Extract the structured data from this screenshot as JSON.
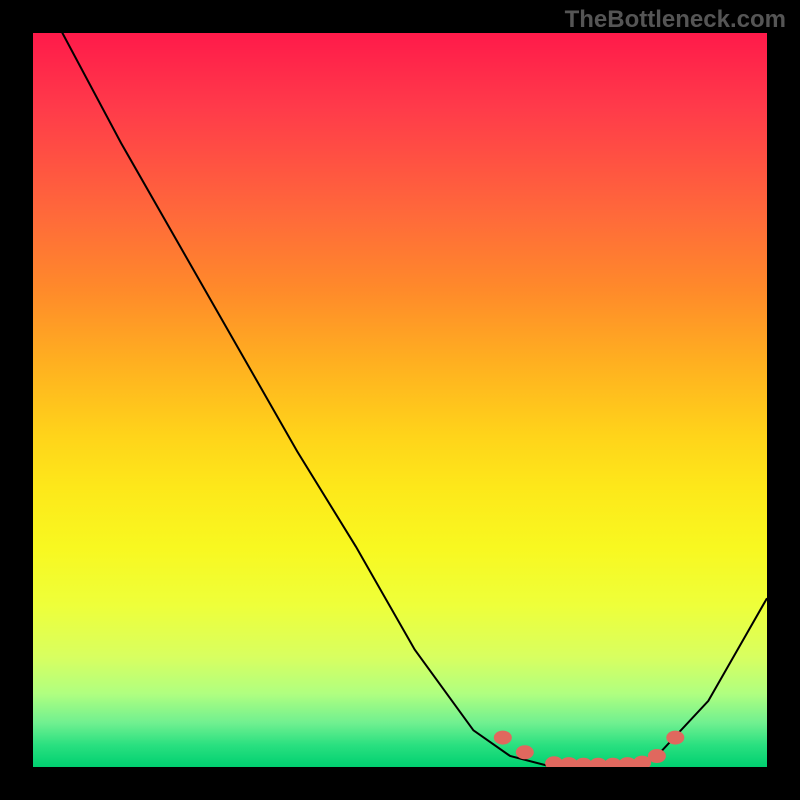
{
  "watermark": "TheBottleneck.com",
  "chart_data": {
    "type": "line",
    "title": "",
    "xlabel": "",
    "ylabel": "",
    "xlim": [
      0,
      100
    ],
    "ylim": [
      0,
      100
    ],
    "grid": false,
    "legend": false,
    "series": [
      {
        "name": "curve",
        "x": [
          0,
          4,
          12,
          20,
          28,
          36,
          44,
          52,
          60,
          65,
          70,
          75,
          80,
          85,
          92,
          100
        ],
        "y": [
          116,
          100,
          85,
          71,
          57,
          43,
          30,
          16,
          5,
          1.5,
          0.2,
          0,
          0,
          1.5,
          9,
          23
        ]
      }
    ],
    "markers": [
      {
        "x": 64,
        "y": 4
      },
      {
        "x": 67,
        "y": 2
      },
      {
        "x": 71,
        "y": 0.5
      },
      {
        "x": 73,
        "y": 0.4
      },
      {
        "x": 75,
        "y": 0.3
      },
      {
        "x": 77,
        "y": 0.3
      },
      {
        "x": 79,
        "y": 0.3
      },
      {
        "x": 81,
        "y": 0.4
      },
      {
        "x": 83,
        "y": 0.6
      },
      {
        "x": 85,
        "y": 1.5
      },
      {
        "x": 87.5,
        "y": 4
      }
    ],
    "background": "rainbow-vertical-gradient"
  }
}
